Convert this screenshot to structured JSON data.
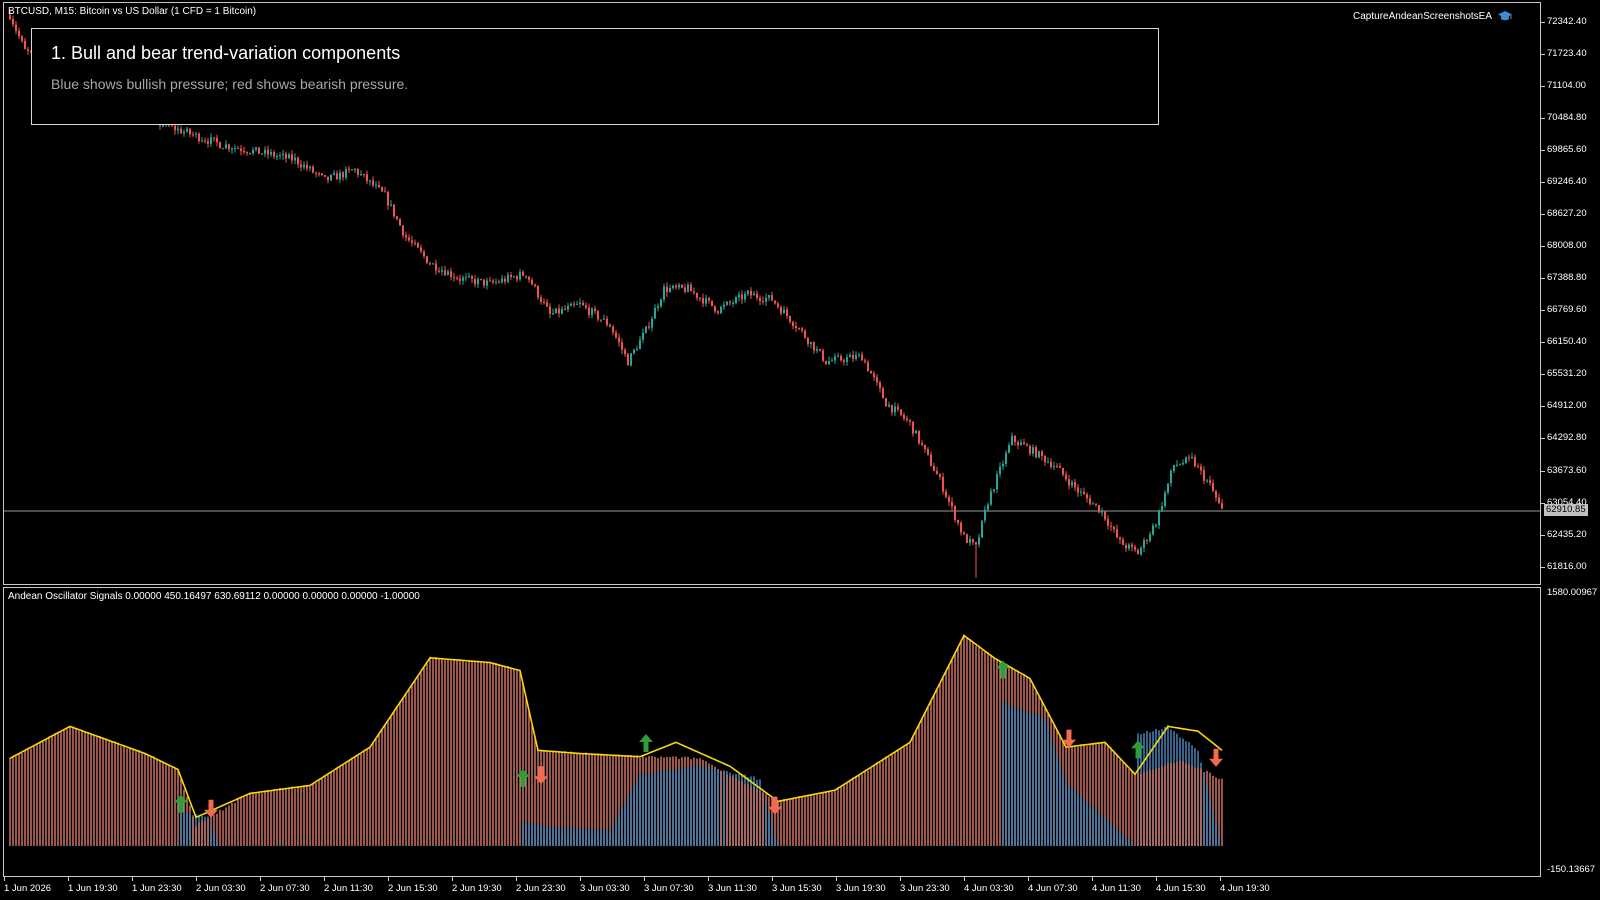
{
  "window": {
    "symbol_title": "BTCUSD, M15:  Bitcoin vs US Dollar (1 CFD = 1 Bitcoin)",
    "ea_label": "CaptureAndeanScreenshotsEA",
    "ea_icon": "graduation-cap-icon"
  },
  "callout": {
    "title": "1. Bull and bear trend-variation components",
    "subtitle": "Blue shows bullish pressure; red shows bearish pressure."
  },
  "price_axis": {
    "ticks": [
      "72342.40",
      "71723.40",
      "71104.00",
      "70484.80",
      "69865.60",
      "69246.40",
      "68627.20",
      "68008.00",
      "67388.80",
      "66769.60",
      "66150.40",
      "65531.20",
      "64912.00",
      "64292.80",
      "63673.60",
      "63054.40",
      "62435.20",
      "61816.00"
    ],
    "current_price": "62910.85"
  },
  "oscillator": {
    "title": "Andean Oscillator Signals 0.00000 450.16497 630.69112 0.00000 0.00000 0.00000 -1.00000",
    "axis_top": "1580.00967",
    "axis_bottom": "-150.13667"
  },
  "time_axis": {
    "ticks": [
      "1 Jun 2026",
      "1 Jun 19:30",
      "1 Jun 23:30",
      "2 Jun 03:30",
      "2 Jun 07:30",
      "2 Jun 11:30",
      "2 Jun 15:30",
      "2 Jun 19:30",
      "2 Jun 23:30",
      "3 Jun 03:30",
      "3 Jun 07:30",
      "3 Jun 11:30",
      "3 Jun 15:30",
      "3 Jun 19:30",
      "3 Jun 23:30",
      "4 Jun 03:30",
      "4 Jun 07:30",
      "4 Jun 11:30",
      "4 Jun 15:30",
      "4 Jun 19:30"
    ]
  },
  "colors": {
    "background": "#000000",
    "bull_candle": "#26a69a",
    "bear_candle": "#ef5350",
    "bull_component": "#4a90c8",
    "bear_component": "#e07a6a",
    "signal_line": "#f5d90a",
    "buy_arrow": "#2e9d3a",
    "sell_arrow": "#f26a4f",
    "grid_border": "#c8c8c8"
  },
  "chart_data": [
    {
      "type": "candlestick",
      "symbol": "BTCUSD",
      "timeframe": "M15",
      "ylim": [
        61500,
        72650
      ],
      "close_anchors": [
        [
          0,
          72500
        ],
        [
          5,
          71800
        ],
        [
          20,
          71400
        ],
        [
          45,
          70500
        ],
        [
          70,
          70000
        ],
        [
          95,
          69700
        ],
        [
          105,
          69300
        ],
        [
          115,
          69500
        ],
        [
          125,
          69000
        ],
        [
          132,
          68200
        ],
        [
          140,
          67700
        ],
        [
          150,
          67400
        ],
        [
          160,
          67300
        ],
        [
          172,
          67500
        ],
        [
          180,
          66700
        ],
        [
          190,
          66900
        ],
        [
          200,
          66500
        ],
        [
          206,
          65800
        ],
        [
          212,
          66400
        ],
        [
          218,
          67200
        ],
        [
          226,
          67200
        ],
        [
          236,
          66800
        ],
        [
          246,
          67100
        ],
        [
          254,
          67000
        ],
        [
          262,
          66500
        ],
        [
          272,
          65800
        ],
        [
          284,
          65900
        ],
        [
          292,
          65000
        ],
        [
          300,
          64600
        ],
        [
          310,
          63500
        ],
        [
          318,
          62400
        ],
        [
          322,
          62200
        ],
        [
          326,
          63100
        ],
        [
          334,
          64300
        ],
        [
          340,
          64100
        ],
        [
          348,
          63800
        ],
        [
          356,
          63300
        ],
        [
          364,
          62900
        ],
        [
          370,
          62300
        ],
        [
          376,
          62100
        ],
        [
          382,
          62700
        ],
        [
          388,
          63800
        ],
        [
          394,
          63900
        ],
        [
          400,
          63400
        ],
        [
          404,
          62910
        ]
      ]
    },
    {
      "type": "bar",
      "name": "Andean Oscillator Signals",
      "ylim": [
        -150.13667,
        1580.00967
      ],
      "bull_anchors": [
        [
          0,
          0
        ],
        [
          56,
          0
        ],
        [
          57,
          220
        ],
        [
          66,
          180
        ],
        [
          70,
          0
        ],
        [
          170,
          0
        ],
        [
          171,
          150
        ],
        [
          180,
          120
        ],
        [
          200,
          100
        ],
        [
          210,
          450
        ],
        [
          230,
          500
        ],
        [
          250,
          420
        ],
        [
          256,
          0
        ],
        [
          330,
          0
        ],
        [
          331,
          900
        ],
        [
          345,
          800
        ],
        [
          352,
          400
        ],
        [
          375,
          0
        ],
        [
          376,
          700
        ],
        [
          386,
          750
        ],
        [
          396,
          600
        ],
        [
          404,
          0
        ]
      ],
      "bear_anchors": [
        [
          0,
          550
        ],
        [
          20,
          750
        ],
        [
          45,
          580
        ],
        [
          56,
          480
        ],
        [
          62,
          130
        ],
        [
          80,
          330
        ],
        [
          100,
          380
        ],
        [
          120,
          620
        ],
        [
          140,
          1180
        ],
        [
          160,
          1150
        ],
        [
          170,
          1100
        ],
        [
          176,
          600
        ],
        [
          190,
          580
        ],
        [
          210,
          560
        ],
        [
          230,
          550
        ],
        [
          256,
          280
        ],
        [
          275,
          350
        ],
        [
          300,
          650
        ],
        [
          318,
          1320
        ],
        [
          328,
          1180
        ],
        [
          340,
          1050
        ],
        [
          352,
          620
        ],
        [
          365,
          650
        ],
        [
          375,
          450
        ],
        [
          390,
          540
        ],
        [
          404,
          420
        ]
      ],
      "signal_anchors": [
        [
          0,
          550
        ],
        [
          20,
          750
        ],
        [
          45,
          580
        ],
        [
          56,
          480
        ],
        [
          62,
          180
        ],
        [
          80,
          330
        ],
        [
          100,
          380
        ],
        [
          120,
          620
        ],
        [
          140,
          1180
        ],
        [
          160,
          1150
        ],
        [
          170,
          1100
        ],
        [
          176,
          600
        ],
        [
          190,
          580
        ],
        [
          210,
          560
        ],
        [
          222,
          650
        ],
        [
          240,
          500
        ],
        [
          256,
          280
        ],
        [
          275,
          350
        ],
        [
          300,
          650
        ],
        [
          318,
          1320
        ],
        [
          328,
          1180
        ],
        [
          340,
          1050
        ],
        [
          352,
          620
        ],
        [
          365,
          650
        ],
        [
          375,
          450
        ],
        [
          386,
          750
        ],
        [
          396,
          720
        ],
        [
          404,
          600
        ]
      ],
      "signals": [
        {
          "bar": 57,
          "type": "buy",
          "value": 260
        },
        {
          "bar": 67,
          "type": "sell",
          "value": 240
        },
        {
          "bar": 171,
          "type": "buy",
          "value": 420
        },
        {
          "bar": 177,
          "type": "sell",
          "value": 450
        },
        {
          "bar": 212,
          "type": "buy",
          "value": 640
        },
        {
          "bar": 255,
          "type": "sell",
          "value": 260
        },
        {
          "bar": 331,
          "type": "buy",
          "value": 1100
        },
        {
          "bar": 353,
          "type": "sell",
          "value": 680
        },
        {
          "bar": 376,
          "type": "buy",
          "value": 600
        },
        {
          "bar": 402,
          "type": "sell",
          "value": 560
        }
      ]
    }
  ]
}
